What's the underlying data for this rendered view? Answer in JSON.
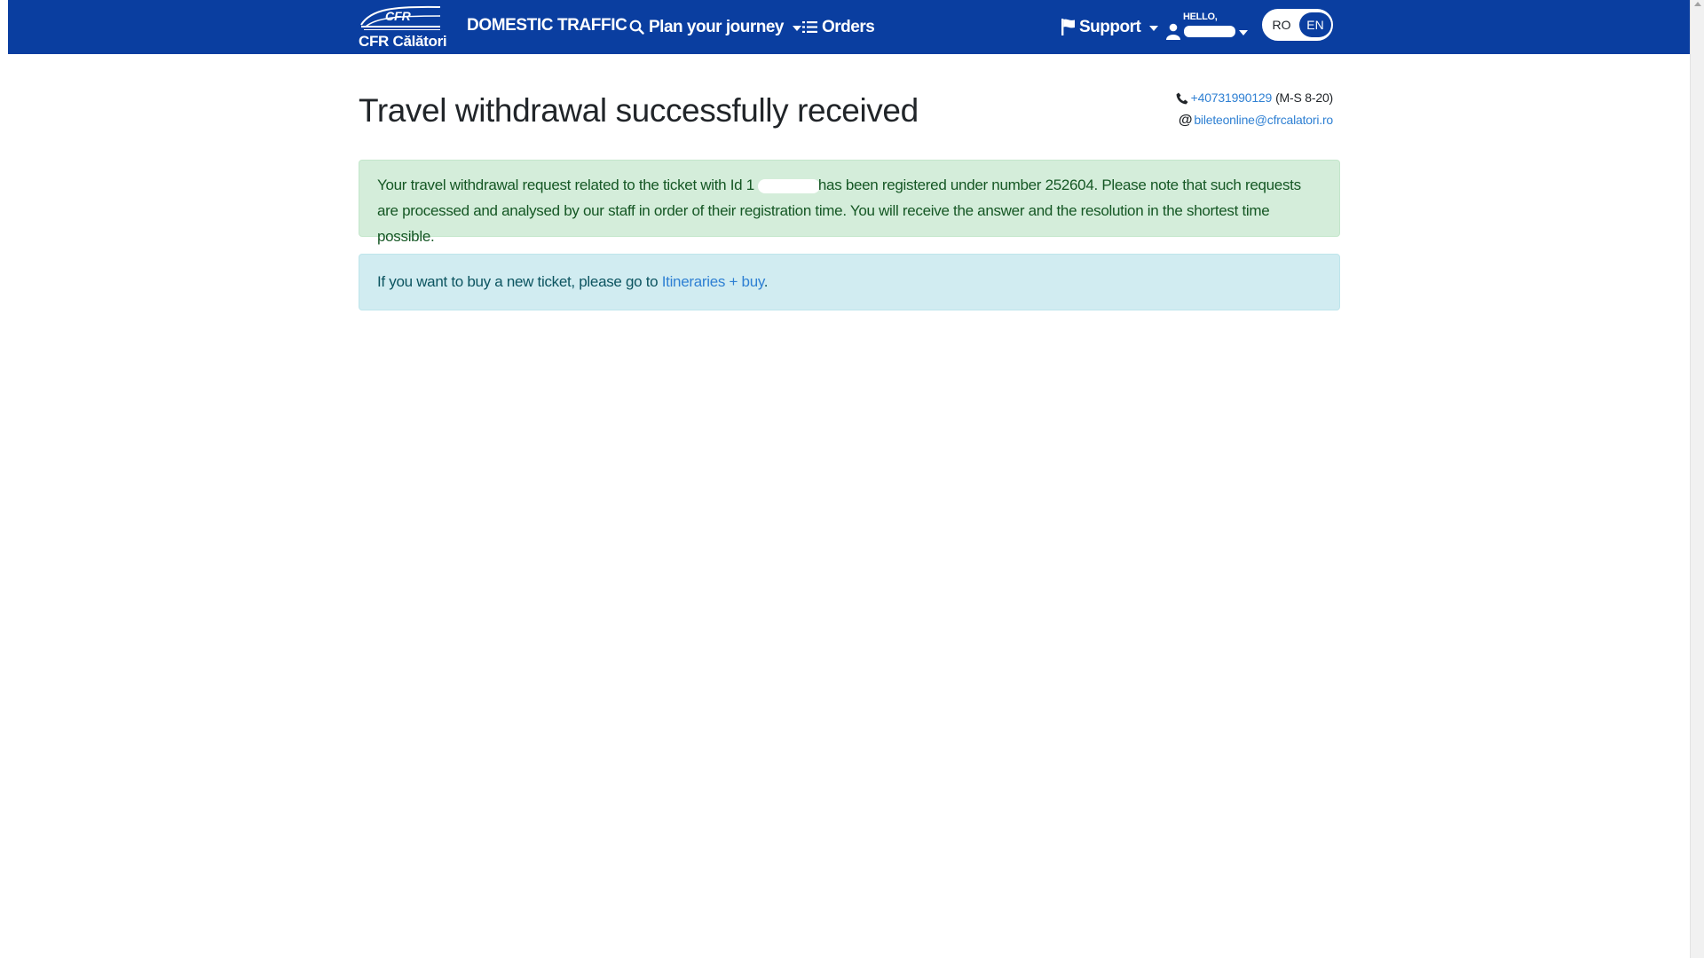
{
  "navbar": {
    "brand_logo_text": "CFR",
    "brand_name": "CFR Călători",
    "domestic": "DOMESTIC TRAFFIC",
    "plan": "Plan your journey",
    "orders": "Orders",
    "support": "Support",
    "user_hello": "HELLO,",
    "lang_ro": "RO",
    "lang_en": "EN"
  },
  "colors": {
    "navbar_bg": "#0a3ea0",
    "success_bg": "#d4edda",
    "info_bg": "#d1ecf1",
    "link": "#2f80d3"
  },
  "page": {
    "title": "Travel withdrawal successfully received"
  },
  "contact": {
    "phone": "+40731990129",
    "hours": "(M-S 8-20)",
    "email": "bileteonline@cfrcalatori.ro"
  },
  "success_alert": {
    "part1": "Your travel withdrawal request related to the ticket with Id 1",
    "part2": "has been registered under number 252604. Please note that such requests are processed and analysed by our staff in order of their registration time. You will receive the answer and the resolution in the shortest time possible."
  },
  "info_alert": {
    "prefix": "If you want to buy a new ticket, please go to ",
    "link": "Itineraries + buy",
    "suffix": "."
  },
  "icons": {
    "brand": "cfr-logo-icon",
    "plan": "search-icon",
    "orders": "list-icon",
    "support": "flag-icon",
    "user": "user-icon",
    "phone": "phone-icon",
    "email": "at-icon"
  }
}
